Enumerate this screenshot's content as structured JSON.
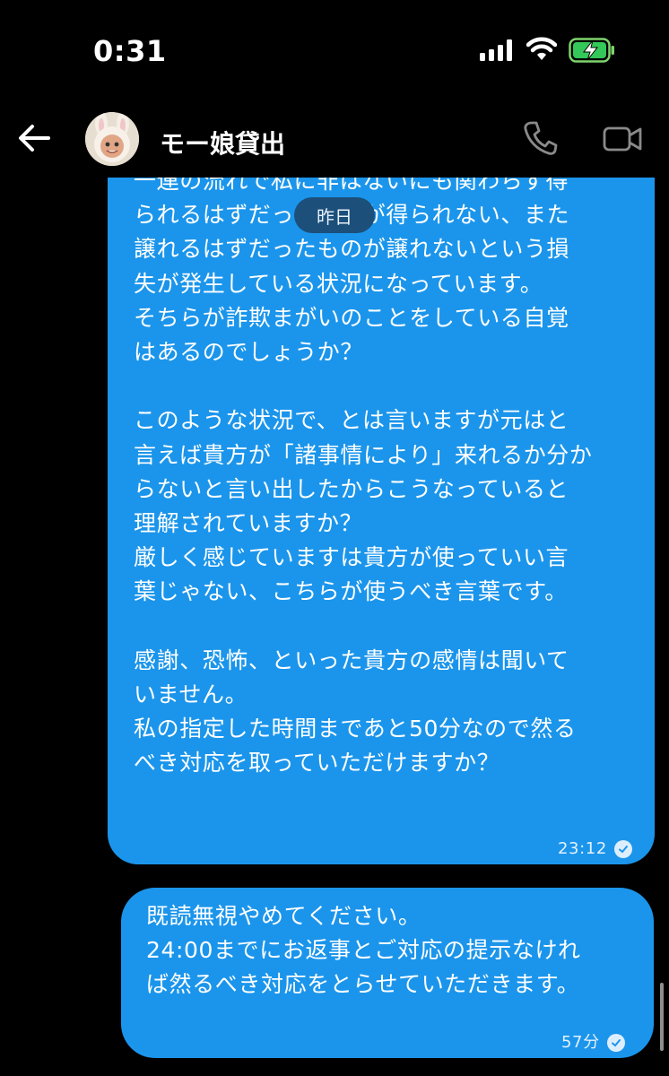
{
  "status": {
    "time": "0:31"
  },
  "header": {
    "contact_name": "モー娘貸出"
  },
  "chat": {
    "date_separator": "昨日",
    "messages": [
      {
        "text": "一連の流れで私に非はないにも関わらず得\nられるはずだったものが得られない、また\n譲れるはずだったものが譲れないという損\n失が発生している状況になっています。\nそちらが詐欺まがいのことをしている自覚\nはあるのでしょうか？\n\nこのような状況で、とは言いますが元はと\n言えば貴方が「諸事情により」来れるか分か\nらないと言い出したからこうなっていると\n理解されていますか？\n厳しく感じていますは貴方が使っていい言\n葉じゃない、こちらが使うべき言葉です。\n\n感謝、恐怖、といった貴方の感情は聞いて\nいません。\n私の指定した時間まであと50分なので然る\nべき対応を取っていただけますか？",
        "time": "23:12"
      },
      {
        "text": "既読無視やめてください。\n24:00までにお返事とご対応の提示なけれ\nば然るべき対応をとらせていただきます。",
        "time": "57分"
      }
    ]
  },
  "colors": {
    "bubble": "#1b95eb",
    "background": "#000000"
  },
  "icons": [
    "signal-icon",
    "wifi-icon",
    "battery-charging-icon",
    "back-arrow-icon",
    "phone-icon",
    "video-call-icon",
    "read-check-icon"
  ]
}
